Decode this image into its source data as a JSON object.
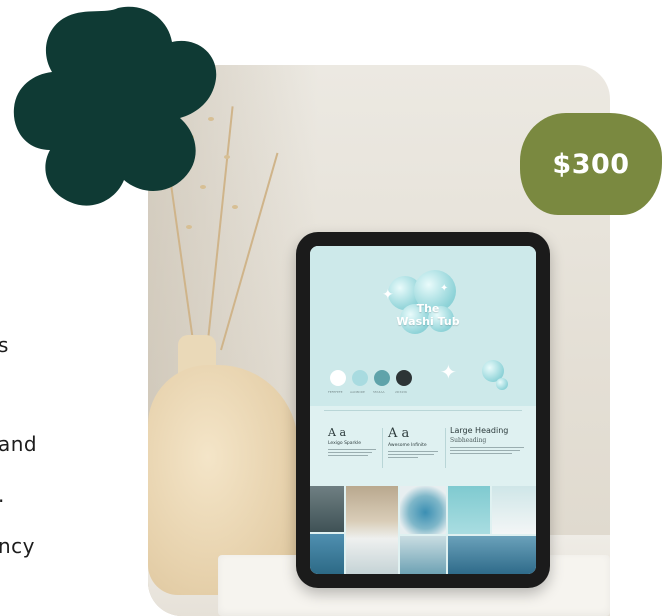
{
  "left_fragments": [
    "s",
    "and",
    ".",
    "ncy"
  ],
  "price": "$300",
  "tablet": {
    "logo_line1": "The",
    "logo_line2": "Washi Tub",
    "palette": [
      {
        "color": "#ffffff",
        "label": "FEFEFEFE"
      },
      {
        "color": "#a8dbe0",
        "label": "AAD8DDE"
      },
      {
        "color": "#5fa3aa",
        "label": "5FA3AA"
      },
      {
        "color": "#2d3436",
        "label": "2D3436"
      }
    ],
    "type_samples": [
      {
        "sample": "A a",
        "name": "Lexigo Sparkle"
      },
      {
        "sample": "A a",
        "name": "Awesome Infinite"
      },
      {
        "sample": "Large Heading",
        "name": "Subheading"
      }
    ]
  },
  "colors": {
    "accent_green": "#7a8940",
    "dark_green": "#0f3a34",
    "screen_teal": "#cde9ea"
  }
}
